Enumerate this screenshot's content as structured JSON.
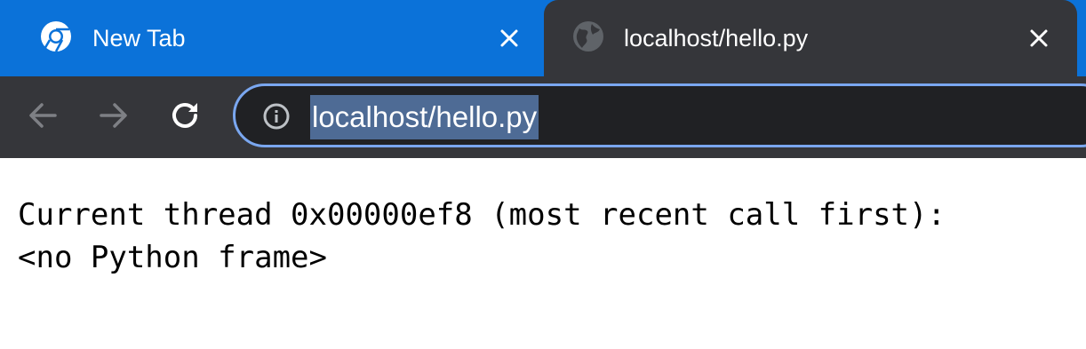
{
  "tabs": [
    {
      "title": "New Tab",
      "icon": "chrome-icon",
      "active": false
    },
    {
      "title": "localhost/hello.py",
      "icon": "globe-icon",
      "active": true
    }
  ],
  "toolbar": {
    "back_icon": "back-arrow-icon",
    "forward_icon": "forward-arrow-icon",
    "reload_icon": "reload-icon"
  },
  "omnibox": {
    "icon": "info-icon",
    "url": "localhost/hello.py"
  },
  "page": {
    "lines": [
      "Current thread 0x00000ef8 (most recent call first):",
      "<no Python frame>"
    ]
  },
  "colors": {
    "tabstrip": "#0b72d9",
    "toolbar": "#35363a",
    "omnibox_border": "#7aa7f0",
    "url_highlight": "#4e6b95"
  }
}
